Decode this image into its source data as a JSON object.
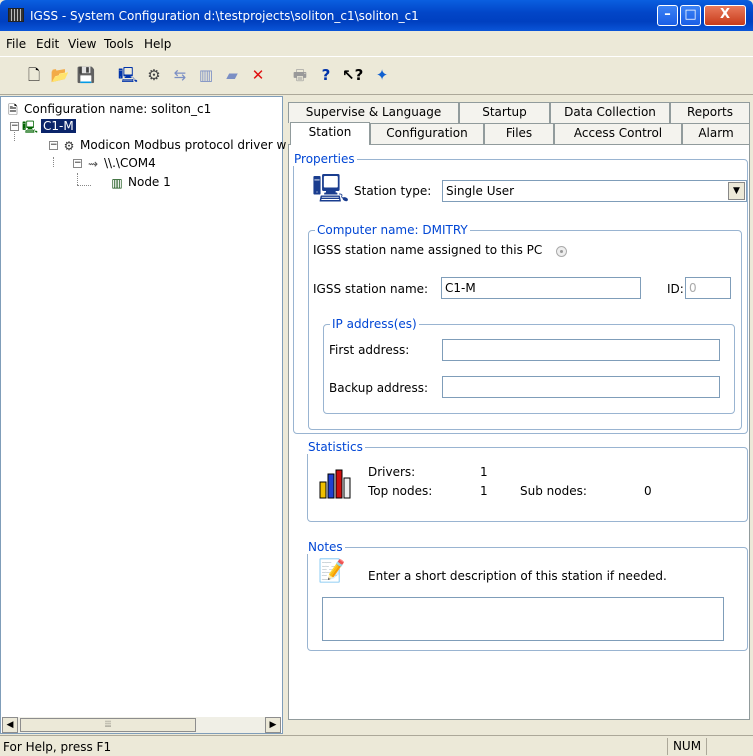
{
  "window": {
    "title": "IGSS - System Configuration d:\\testprojects\\soliton_c1\\soliton_c1",
    "min": "–",
    "max": "□",
    "close": "X"
  },
  "menu": [
    "File",
    "Edit",
    "View",
    "Tools",
    "Help"
  ],
  "tree": {
    "config_name": "Configuration name: soliton_c1",
    "station": "C1-M",
    "driver": "Modicon Modbus protocol driver w",
    "port": "\\\\.\\COM4",
    "node": "Node 1"
  },
  "tabs_row1": [
    "Supervise & Language",
    "Startup",
    "Data Collection",
    "Reports"
  ],
  "tabs_row2": [
    "Station",
    "Configuration",
    "Files",
    "Access Control",
    "Alarm"
  ],
  "properties": {
    "group_title": "Properties",
    "station_type_label": "Station type:",
    "station_type_value": "Single User"
  },
  "computer": {
    "group_title": "Computer name: DMITRY",
    "assigned_label": "IGSS station name assigned to this PC",
    "station_name_label": "IGSS station name:",
    "station_name_value": "C1-M",
    "id_label": "ID:",
    "id_value": "0"
  },
  "ip": {
    "group_title": "IP address(es)",
    "first_label": "First address:",
    "first_value": "",
    "backup_label": "Backup address:",
    "backup_value": ""
  },
  "statistics": {
    "group_title": "Statistics",
    "drivers_label": "Drivers:",
    "drivers_value": "1",
    "top_nodes_label": "Top nodes:",
    "top_nodes_value": "1",
    "sub_nodes_label": "Sub nodes:",
    "sub_nodes_value": "0"
  },
  "notes": {
    "group_title": "Notes",
    "hint": "Enter a short description of this station if needed.",
    "value": ""
  },
  "status": {
    "help": "For Help, press F1",
    "num": "NUM"
  }
}
